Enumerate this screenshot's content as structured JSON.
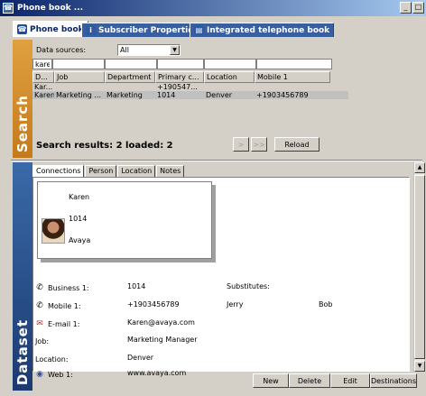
{
  "window": {
    "title": "Phone book ...",
    "icon": "phonebook-icon",
    "buttons": [
      "_",
      "□"
    ]
  },
  "tabs": [
    {
      "label": "Phone book",
      "icon": "phone-icon"
    },
    {
      "label": "Subscriber Properties",
      "icon": "info-icon"
    },
    {
      "label": "Integrated telephone book",
      "icon": "book-icon"
    }
  ],
  "search": {
    "side_label": "Search",
    "data_sources_label": "Data sources:",
    "data_sources_value": "All",
    "filter_value": "karel",
    "columns": [
      "D...",
      "Job",
      "Department",
      "Primary c...",
      "Location",
      "Mobile 1"
    ],
    "rows": [
      [
        "Kar...",
        "",
        "",
        "+190547...",
        "",
        ""
      ],
      [
        "Karen",
        "Marketing ...",
        "Marketing",
        "1014",
        "Denver",
        "+1903456789"
      ]
    ],
    "results_text": "Search results:  2   loaded:  2",
    "next_label": ">",
    "next_all_label": ">>",
    "reload_label": "Reload"
  },
  "dataset": {
    "side_label": "Dataset",
    "subtabs": [
      "Connections",
      "Person",
      "Location",
      "Notes"
    ],
    "card": {
      "name": "Karen",
      "extension": "1014",
      "company": "Avaya"
    },
    "fields": [
      {
        "icon": "phone-icon",
        "label": "Business 1:",
        "value": "1014"
      },
      {
        "icon": "mobile-icon",
        "label": "Mobile 1:",
        "value": "+1903456789"
      },
      {
        "icon": "email-icon",
        "label": "E-mail 1:",
        "value": "Karen@avaya.com"
      },
      {
        "icon": "",
        "label": "Job:",
        "value": "Marketing Manager"
      },
      {
        "icon": "",
        "label": "Location:",
        "value": "Denver"
      },
      {
        "icon": "web-icon",
        "label": "Web 1:",
        "value": "www.avaya.com"
      }
    ],
    "substitutes_label": "Substitutes:",
    "substitutes": [
      "Jerry",
      "Bob"
    ],
    "buttons": {
      "new": "New",
      "delete": "Delete",
      "edit": "Edit",
      "destinations": "Destinations"
    }
  }
}
